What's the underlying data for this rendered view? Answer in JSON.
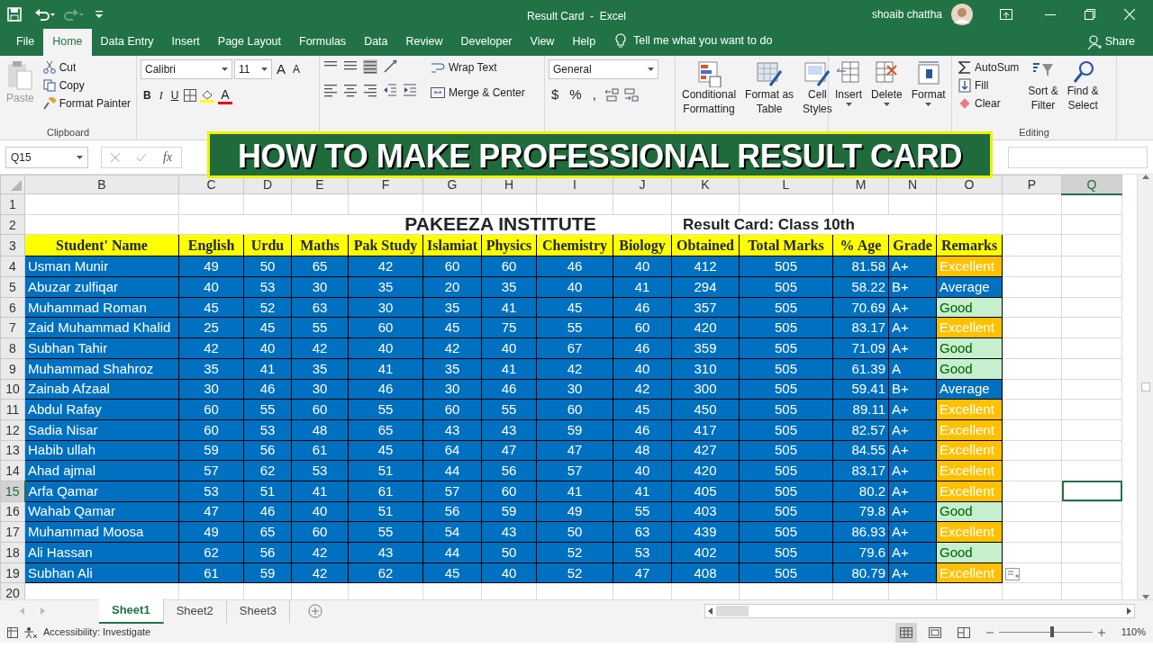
{
  "window": {
    "title": "Result Card  -  Excel",
    "user": "shoaib chattha"
  },
  "menu_tabs": [
    {
      "label": "File",
      "selected": false
    },
    {
      "label": "Home",
      "selected": true
    },
    {
      "label": "Data Entry",
      "selected": false
    },
    {
      "label": "Insert",
      "selected": false
    },
    {
      "label": "Page Layout",
      "selected": false
    },
    {
      "label": "Formulas",
      "selected": false
    },
    {
      "label": "Data",
      "selected": false
    },
    {
      "label": "Review",
      "selected": false
    },
    {
      "label": "Developer",
      "selected": false
    },
    {
      "label": "View",
      "selected": false
    },
    {
      "label": "Help",
      "selected": false
    }
  ],
  "tell_me": "Tell me what you want to do",
  "share": "Share",
  "clipboard": {
    "paste": "Paste",
    "cut": "Cut",
    "copy": "Copy",
    "format_painter": "Format Painter",
    "label": "Clipboard"
  },
  "font": {
    "name": "Calibri",
    "size": "11",
    "grow": "A",
    "shrink": "A",
    "bold": "B",
    "italic": "I",
    "underline": "U",
    "font_color": "A"
  },
  "alignment": {
    "wrap": "Wrap Text",
    "merge": "Merge & Center"
  },
  "number": {
    "format": "General",
    "currency": "$",
    "percent": "%",
    "comma": ","
  },
  "styles": [
    {
      "lines": [
        "Conditional",
        "Formatting"
      ]
    },
    {
      "lines": [
        "Format as",
        "Table"
      ]
    },
    {
      "lines": [
        "Cell",
        "Styles"
      ]
    }
  ],
  "cells": [
    {
      "label": "Insert"
    },
    {
      "label": "Delete"
    },
    {
      "label": "Format"
    }
  ],
  "editing": {
    "autosum": "AutoSum",
    "fill": "Fill",
    "clear": "Clear",
    "sort": [
      "Sort &",
      "Filter"
    ],
    "find": [
      "Find &",
      "Select"
    ],
    "label": "Editing"
  },
  "banner": "HOW TO MAKE PROFESSIONAL RESULT CARD",
  "formula_bar": {
    "name_box": "Q15",
    "fx": "fx"
  },
  "columns": [
    {
      "label": "B",
      "selected": false
    },
    {
      "label": "C",
      "selected": false
    },
    {
      "label": "D",
      "selected": false
    },
    {
      "label": "E",
      "selected": false
    },
    {
      "label": "F",
      "selected": false
    },
    {
      "label": "G",
      "selected": false
    },
    {
      "label": "H",
      "selected": false
    },
    {
      "label": "I",
      "selected": false
    },
    {
      "label": "J",
      "selected": false
    },
    {
      "label": "K",
      "selected": false
    },
    {
      "label": "L",
      "selected": false
    },
    {
      "label": "M",
      "selected": false
    },
    {
      "label": "N",
      "selected": false
    },
    {
      "label": "O",
      "selected": false
    },
    {
      "label": "P",
      "selected": false
    },
    {
      "label": "Q",
      "selected": true
    }
  ],
  "row_numbers": [
    {
      "label": "1",
      "selected": false
    },
    {
      "label": "2",
      "selected": false
    },
    {
      "label": "3",
      "selected": false
    },
    {
      "label": "4",
      "selected": false
    },
    {
      "label": "5",
      "selected": false
    },
    {
      "label": "6",
      "selected": false
    },
    {
      "label": "7",
      "selected": false
    },
    {
      "label": "8",
      "selected": false
    },
    {
      "label": "9",
      "selected": false
    },
    {
      "label": "10",
      "selected": false
    },
    {
      "label": "11",
      "selected": false
    },
    {
      "label": "12",
      "selected": false
    },
    {
      "label": "13",
      "selected": false
    },
    {
      "label": "14",
      "selected": false
    },
    {
      "label": "15",
      "selected": true
    },
    {
      "label": "16",
      "selected": false
    },
    {
      "label": "17",
      "selected": false
    },
    {
      "label": "18",
      "selected": false
    },
    {
      "label": "19",
      "selected": false
    },
    {
      "label": "20",
      "selected": false
    }
  ],
  "sheet_title": "PAKEEZA INSTITUTE",
  "sheet_subtitle": "Result Card: Class 10th",
  "headers": [
    "Student' Name",
    "English",
    "Urdu",
    "Maths",
    "Pak Study",
    "Islamiat",
    "Physics",
    "Chemistry",
    "Biology",
    "Obtained",
    "Total Marks",
    "% Age",
    "Grade",
    "Remarks"
  ],
  "rows": [
    {
      "name": "Usman Munir",
      "values": [
        "49",
        "50",
        "65",
        "42",
        "60",
        "60",
        "46",
        "40",
        "412",
        "505",
        "81.58"
      ],
      "grade": "A+",
      "remark": {
        "text": "Excellent",
        "color": "#ffc000"
      }
    },
    {
      "name": "Abuzar zulfiqar",
      "values": [
        "40",
        "53",
        "30",
        "35",
        "20",
        "35",
        "40",
        "41",
        "294",
        "505",
        "58.22"
      ],
      "grade": "B+",
      "remark": {
        "text": "Average",
        "color": "#0070c0"
      }
    },
    {
      "name": "Muhammad Roman",
      "values": [
        "45",
        "52",
        "63",
        "30",
        "35",
        "41",
        "45",
        "46",
        "357",
        "505",
        "70.69"
      ],
      "grade": "A+",
      "remark": {
        "text": "Good",
        "color": "#c6efce"
      }
    },
    {
      "name": "Zaid Muhammad Khalid",
      "values": [
        "25",
        "45",
        "55",
        "60",
        "45",
        "75",
        "55",
        "60",
        "420",
        "505",
        "83.17"
      ],
      "grade": "A+",
      "remark": {
        "text": "Excellent",
        "color": "#ffc000"
      }
    },
    {
      "name": "Subhan Tahir",
      "values": [
        "42",
        "40",
        "42",
        "40",
        "42",
        "40",
        "67",
        "46",
        "359",
        "505",
        "71.09"
      ],
      "grade": "A+",
      "remark": {
        "text": "Good",
        "color": "#c6efce"
      }
    },
    {
      "name": "Muhammad Shahroz",
      "values": [
        "35",
        "41",
        "35",
        "41",
        "35",
        "41",
        "42",
        "40",
        "310",
        "505",
        "61.39"
      ],
      "grade": "A",
      "remark": {
        "text": "Good",
        "color": "#c6efce"
      }
    },
    {
      "name": "Zainab Afzaal",
      "values": [
        "30",
        "46",
        "30",
        "46",
        "30",
        "46",
        "30",
        "42",
        "300",
        "505",
        "59.41"
      ],
      "grade": "B+",
      "remark": {
        "text": "Average",
        "color": "#0070c0"
      }
    },
    {
      "name": "Abdul Rafay",
      "values": [
        "60",
        "55",
        "60",
        "55",
        "60",
        "55",
        "60",
        "45",
        "450",
        "505",
        "89.11"
      ],
      "grade": "A+",
      "remark": {
        "text": "Excellent",
        "color": "#ffc000"
      }
    },
    {
      "name": "Sadia Nisar",
      "values": [
        "60",
        "53",
        "48",
        "65",
        "43",
        "43",
        "59",
        "46",
        "417",
        "505",
        "82.57"
      ],
      "grade": "A+",
      "remark": {
        "text": "Excellent",
        "color": "#ffc000"
      }
    },
    {
      "name": "Habib ullah",
      "values": [
        "59",
        "56",
        "61",
        "45",
        "64",
        "47",
        "47",
        "48",
        "427",
        "505",
        "84.55"
      ],
      "grade": "A+",
      "remark": {
        "text": "Excellent",
        "color": "#ffc000"
      }
    },
    {
      "name": "Ahad ajmal",
      "values": [
        "57",
        "62",
        "53",
        "51",
        "44",
        "56",
        "57",
        "40",
        "420",
        "505",
        "83.17"
      ],
      "grade": "A+",
      "remark": {
        "text": "Excellent",
        "color": "#ffc000"
      }
    },
    {
      "name": "Arfa Qamar",
      "values": [
        "53",
        "51",
        "41",
        "61",
        "57",
        "60",
        "41",
        "41",
        "405",
        "505",
        "80.2"
      ],
      "grade": "A+",
      "remark": {
        "text": "Excellent",
        "color": "#ffc000"
      }
    },
    {
      "name": "Wahab Qamar",
      "values": [
        "47",
        "46",
        "40",
        "51",
        "56",
        "59",
        "49",
        "55",
        "403",
        "505",
        "79.8"
      ],
      "grade": "A+",
      "remark": {
        "text": "Good",
        "color": "#c6efce"
      }
    },
    {
      "name": "Muhammad Moosa",
      "values": [
        "49",
        "65",
        "60",
        "55",
        "54",
        "43",
        "50",
        "63",
        "439",
        "505",
        "86.93"
      ],
      "grade": "A+",
      "remark": {
        "text": "Excellent",
        "color": "#ffc000"
      }
    },
    {
      "name": "Ali Hassan",
      "values": [
        "62",
        "56",
        "42",
        "43",
        "44",
        "50",
        "52",
        "53",
        "402",
        "505",
        "79.6"
      ],
      "grade": "A+",
      "remark": {
        "text": "Good",
        "color": "#c6efce"
      }
    },
    {
      "name": "Subhan Ali",
      "values": [
        "61",
        "59",
        "42",
        "62",
        "45",
        "40",
        "52",
        "47",
        "408",
        "505",
        "80.79"
      ],
      "grade": "A+",
      "remark": {
        "text": "Excellent",
        "color": "#ffc000"
      }
    }
  ],
  "sheet_tabs": [
    {
      "label": "Sheet1",
      "selected": true
    },
    {
      "label": "Sheet2",
      "selected": false
    },
    {
      "label": "Sheet3",
      "selected": false
    }
  ],
  "status": {
    "accessibility": "Accessibility: Investigate",
    "zoom": "110%",
    "level": 0.55
  }
}
